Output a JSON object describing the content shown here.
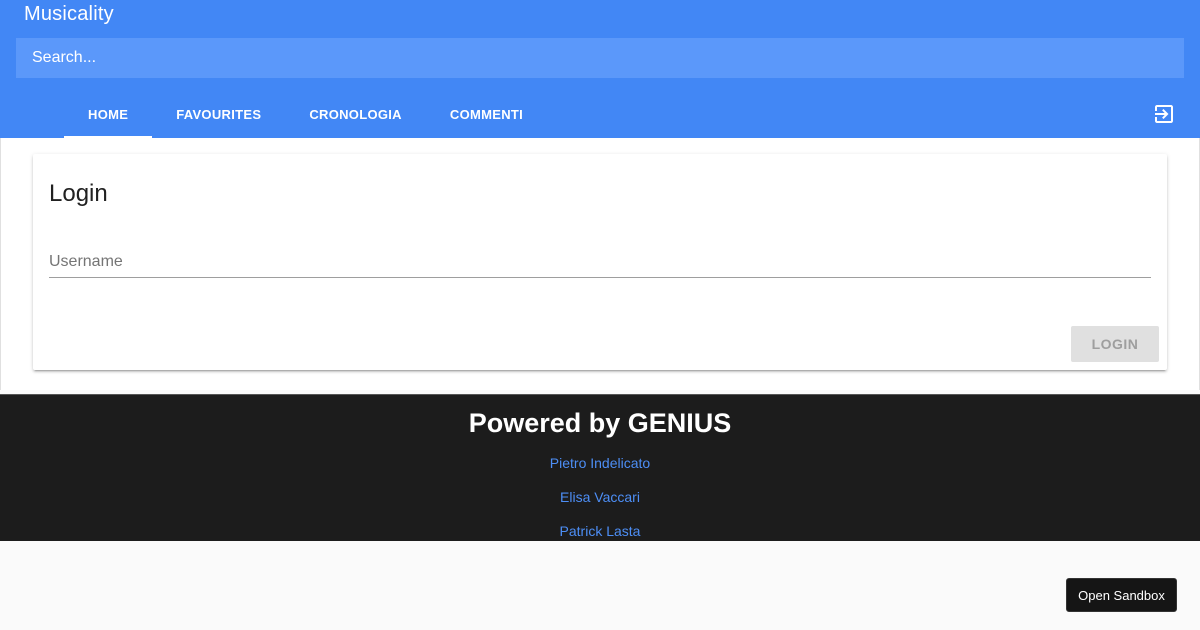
{
  "app": {
    "title": "Musicality",
    "search_placeholder": "Search...",
    "accent_color": "#4287f5"
  },
  "tabs": [
    {
      "label": "HOME",
      "active": true
    },
    {
      "label": "FAVOURITES",
      "active": false
    },
    {
      "label": "CRONOLOGIA",
      "active": false
    },
    {
      "label": "COMMENTI",
      "active": false
    }
  ],
  "logout": {
    "icon": "logout-icon"
  },
  "login_card": {
    "title": "Login",
    "username_label": "Username",
    "button_label": "LOGIN"
  },
  "footer": {
    "title": "Powered by GENIUS",
    "links": [
      "Pietro Indelicato",
      "Elisa Vaccari",
      "Patrick Lasta"
    ],
    "link_color": "#4d8ef5"
  },
  "sandbox": {
    "label": "Open Sandbox"
  }
}
